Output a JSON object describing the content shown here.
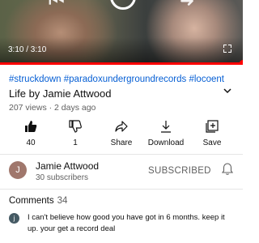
{
  "player": {
    "time": "3:10 / 3:10",
    "progress_fraction": 1.0
  },
  "video": {
    "hashtags": "#struckdown #paradoxundergroundrecords #locoent",
    "title": "Life  by Jamie Attwood",
    "meta": "207 views · 2 days ago"
  },
  "actions": {
    "like_count": "40",
    "dislike_count": "1",
    "share_label": "Share",
    "download_label": "Download",
    "save_label": "Save"
  },
  "channel": {
    "avatar_letter": "J",
    "name": "Jamie Attwood",
    "subscribers": "30 subscribers",
    "subscribe_state": "SUBSCRIBED"
  },
  "comments": {
    "label": "Comments",
    "count": "34",
    "top": {
      "avatar_letter": "j",
      "text": "I can't believe how good you have got in 6 months. keep it up. your get a record deal"
    }
  },
  "icons": {
    "like": "thumbs-up-filled-icon",
    "dislike": "thumbs-down-icon",
    "share": "share-arrow-icon",
    "download": "download-icon",
    "save": "playlist-add-icon",
    "bell": "notification-bell-icon",
    "expand": "chevron-down-icon",
    "fullscreen": "fullscreen-icon"
  },
  "colors": {
    "accent_red": "#ff0000",
    "link_blue": "#065fd4",
    "muted_text": "#606060"
  }
}
